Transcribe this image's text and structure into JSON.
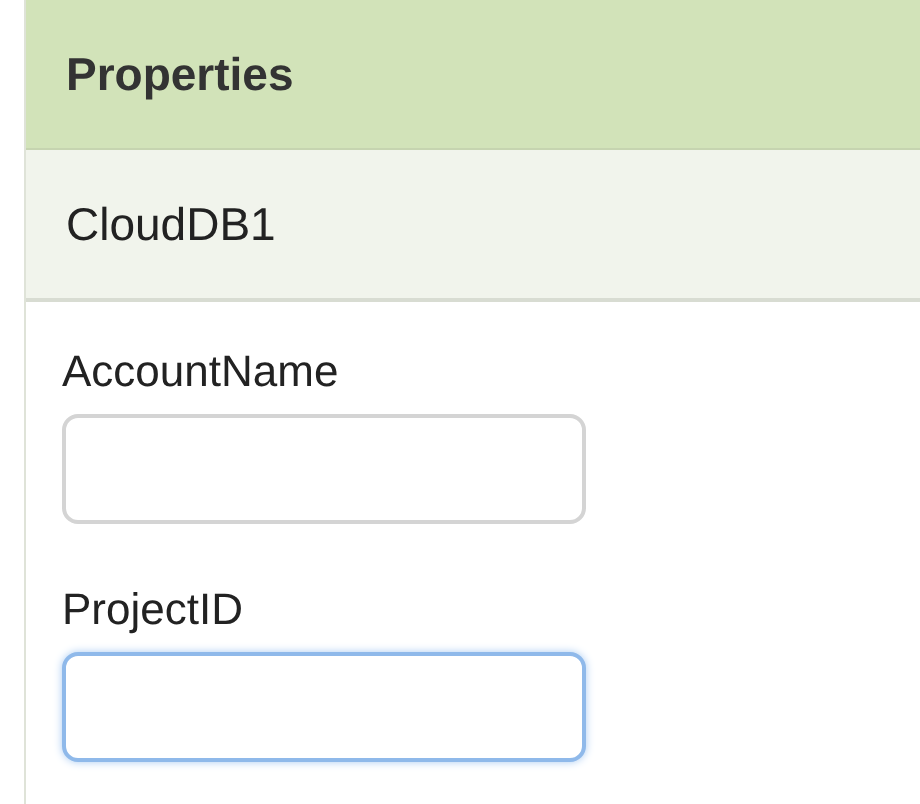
{
  "panel": {
    "title": "Properties"
  },
  "component": {
    "name": "CloudDB1"
  },
  "properties": [
    {
      "label": "AccountName",
      "focused": false
    },
    {
      "label": "ProjectID",
      "focused": true
    }
  ]
}
